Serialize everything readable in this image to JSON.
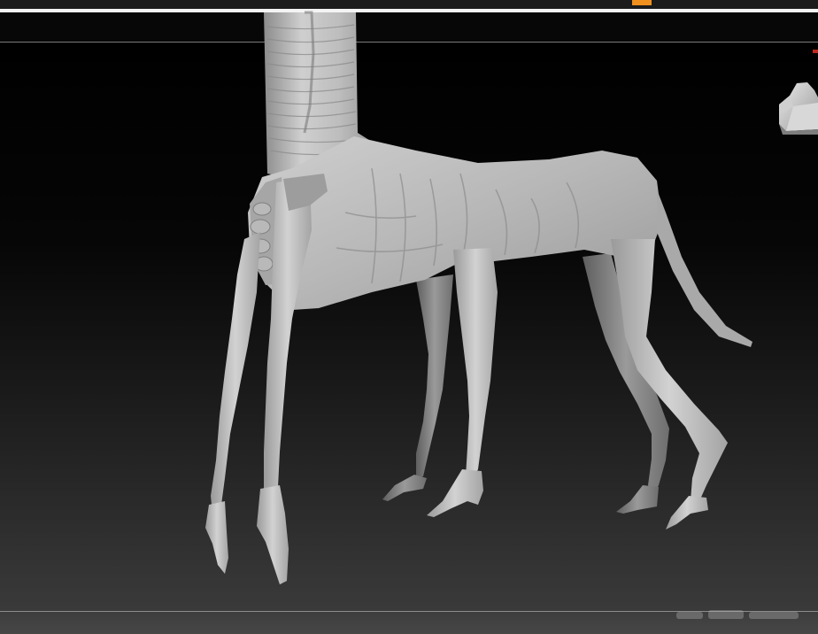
{
  "app": {
    "accent_color": "#f0901e",
    "viewport_background": "#000000"
  },
  "toolbar": {
    "active_indicator_color": "#f0901e"
  },
  "navigation": {
    "cube_icon": "head-gizmo-icon"
  },
  "canvas": {
    "model_icon": "sculpt-creature-model",
    "material": "gray-clay"
  }
}
